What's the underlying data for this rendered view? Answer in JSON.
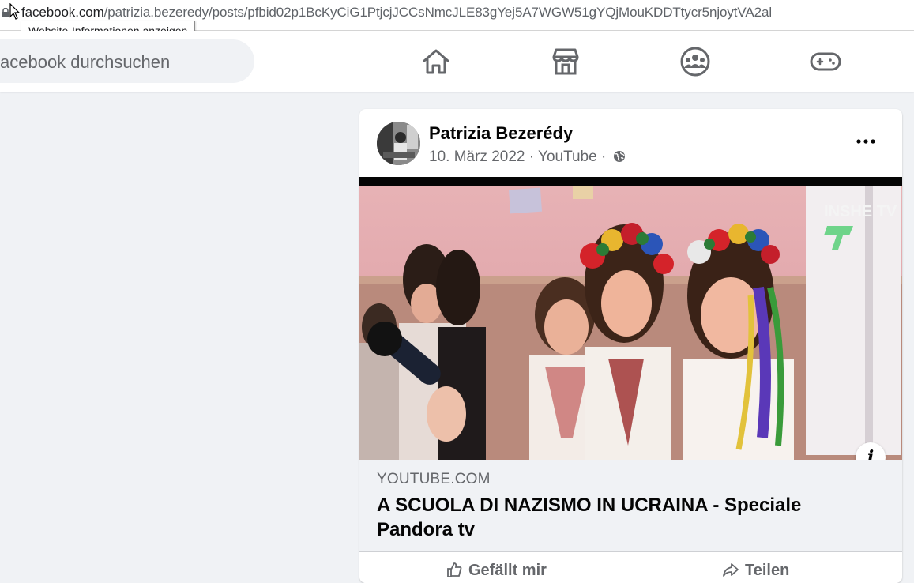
{
  "browser": {
    "url_domain": "facebook.com",
    "url_path": "/patrizia.bezeredy/posts/pfbid02p1BcKyCiG1PtjcjJCCsNmcJLE83gYej5A7WGW51gYQjMouKDDTtycr5njoytVA2al",
    "tooltip": "Website-Informationen anzeigen"
  },
  "topbar": {
    "search_placeholder": "acebook durchsuchen",
    "nav": [
      "home-icon",
      "marketplace-icon",
      "groups-icon",
      "gaming-icon"
    ]
  },
  "post": {
    "author": "Patrizia Bezerédy",
    "date": "10. März 2022",
    "source": "YouTube",
    "meta_separator": " · ",
    "link_domain": "YOUTUBE.COM",
    "link_title": "A SCUOLA DI NAZISMO IN UCRAINA - Speciale Pandora tv",
    "video_watermark": "INSHE TV",
    "actions": [
      "Gefällt mir",
      "Teilen"
    ]
  },
  "colors": {
    "page_bg": "#f0f2f5",
    "text_primary": "#050505",
    "text_secondary": "#65676b",
    "icon": "#65676b"
  }
}
